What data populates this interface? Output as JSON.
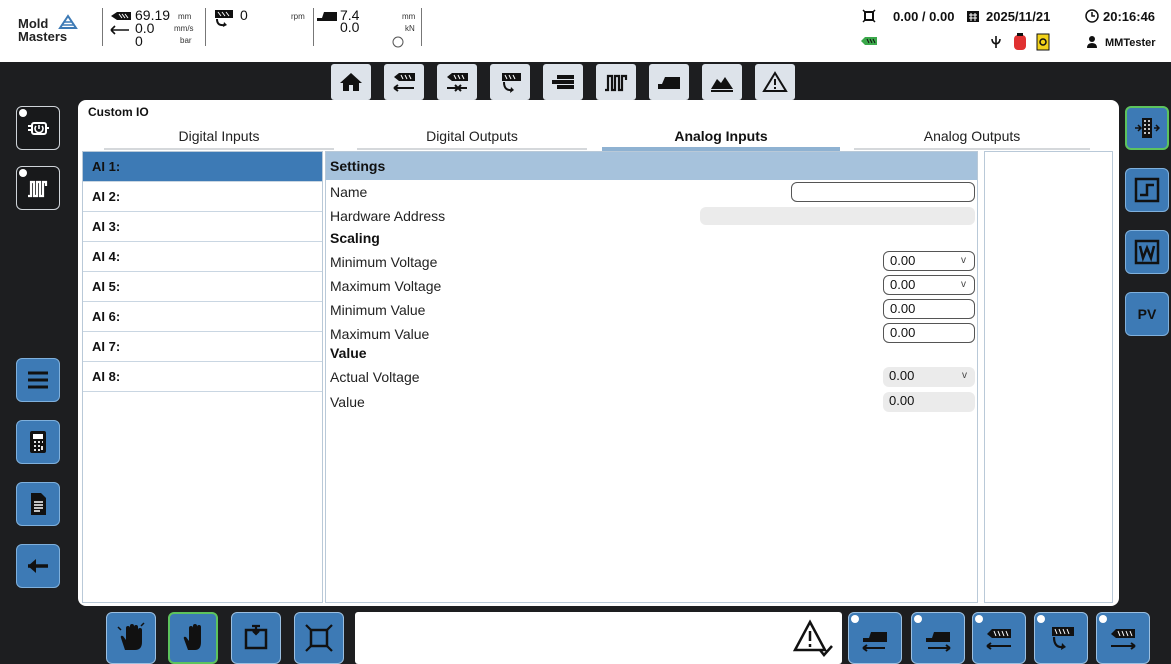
{
  "topbar": {
    "logo_line1": "Mold",
    "logo_line2": "Masters",
    "injection_pos": "69.19",
    "injection_speed": "0.0",
    "injection_pressure": "0",
    "unit_mm": "mm",
    "unit_mms": "mm/s",
    "unit_bar": "bar",
    "screw_rpm": "0",
    "unit_rpm": "rpm",
    "clamp_pos": "7.4",
    "clamp_force": "0.0",
    "unit_clamp_mm": "mm",
    "unit_kn": "kN",
    "cycle_times": "0.00 / 0.00",
    "date": "2025/11/21",
    "time": "20:16:46",
    "user": "MMTester"
  },
  "nav_icons": [
    "home-icon",
    "injection-back-icon",
    "injection-hold-icon",
    "screw-recovery-icon",
    "ejector-icon",
    "temperature-zones-icon",
    "clamp-icon",
    "chart-icon",
    "warning-icon"
  ],
  "screen": {
    "title": "Custom IO",
    "tabs": [
      "Digital Inputs",
      "Digital Outputs",
      "Analog Inputs",
      "Analog Outputs"
    ],
    "active_tab": "Analog Inputs"
  },
  "ai_list": [
    "AI 1:",
    "AI 2:",
    "AI 3:",
    "AI 4:",
    "AI 5:",
    "AI 6:",
    "AI 7:",
    "AI 8:"
  ],
  "settings": {
    "header": "Settings",
    "name_label": "Name",
    "name_value": "",
    "hw_label": "Hardware Address",
    "hw_value": "",
    "scaling_label": "Scaling",
    "min_voltage_label": "Minimum Voltage",
    "min_voltage_value": "0.00",
    "max_voltage_label": "Maximum Voltage",
    "max_voltage_value": "0.00",
    "min_value_label": "Minimum Value",
    "min_value_value": "0.00",
    "max_value_label": "Maximum Value",
    "max_value_value": "0.00",
    "value_section_label": "Value",
    "actual_voltage_label": "Actual Voltage",
    "actual_voltage_value": "0.00",
    "value_label": "Value",
    "value_value": "0.00",
    "voltage_unit": "v"
  },
  "left_buttons": [
    "heaters-icon",
    "temperature-zones-icon",
    "menu-icon",
    "calculator-icon",
    "document-icon",
    "back-arrow-icon"
  ],
  "right_buttons": [
    "io-module-icon",
    "digital-signal-icon",
    "analog-signal-icon"
  ],
  "right_pv_label": "PV",
  "bottom_buttons": [
    "manual-setup-icon",
    "manual-hand-icon",
    "semi-auto-icon",
    "auto-cycle-icon",
    "injection-carriage-back-icon",
    "injection-carriage-forward-icon",
    "injection-retract-icon",
    "screw-recovery-icon",
    "injection-forward-icon"
  ],
  "colors": {
    "accent": "#3d7ab5",
    "active_border": "#5dc35d",
    "settings_header": "#a6c2dc"
  }
}
